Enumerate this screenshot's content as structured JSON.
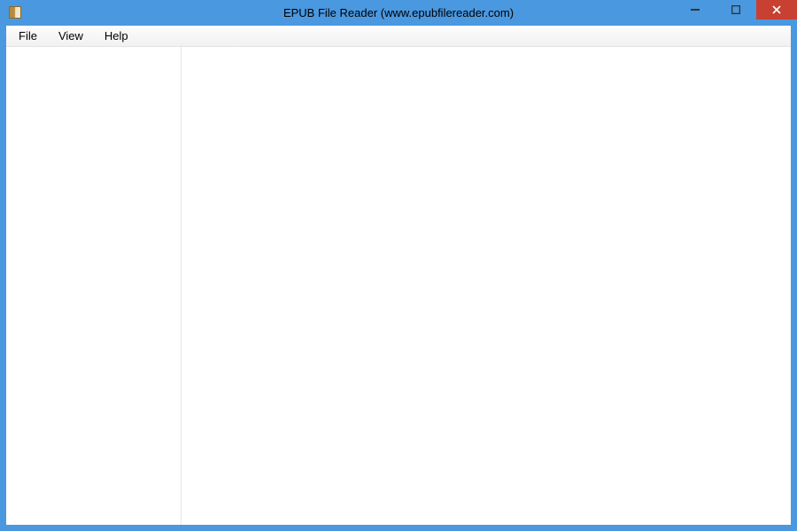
{
  "window": {
    "title": "EPUB File Reader (www.epubfilereader.com)"
  },
  "menu": {
    "file": "File",
    "view": "View",
    "help": "Help"
  },
  "colors": {
    "frame": "#4a98e0",
    "close": "#c84031"
  }
}
